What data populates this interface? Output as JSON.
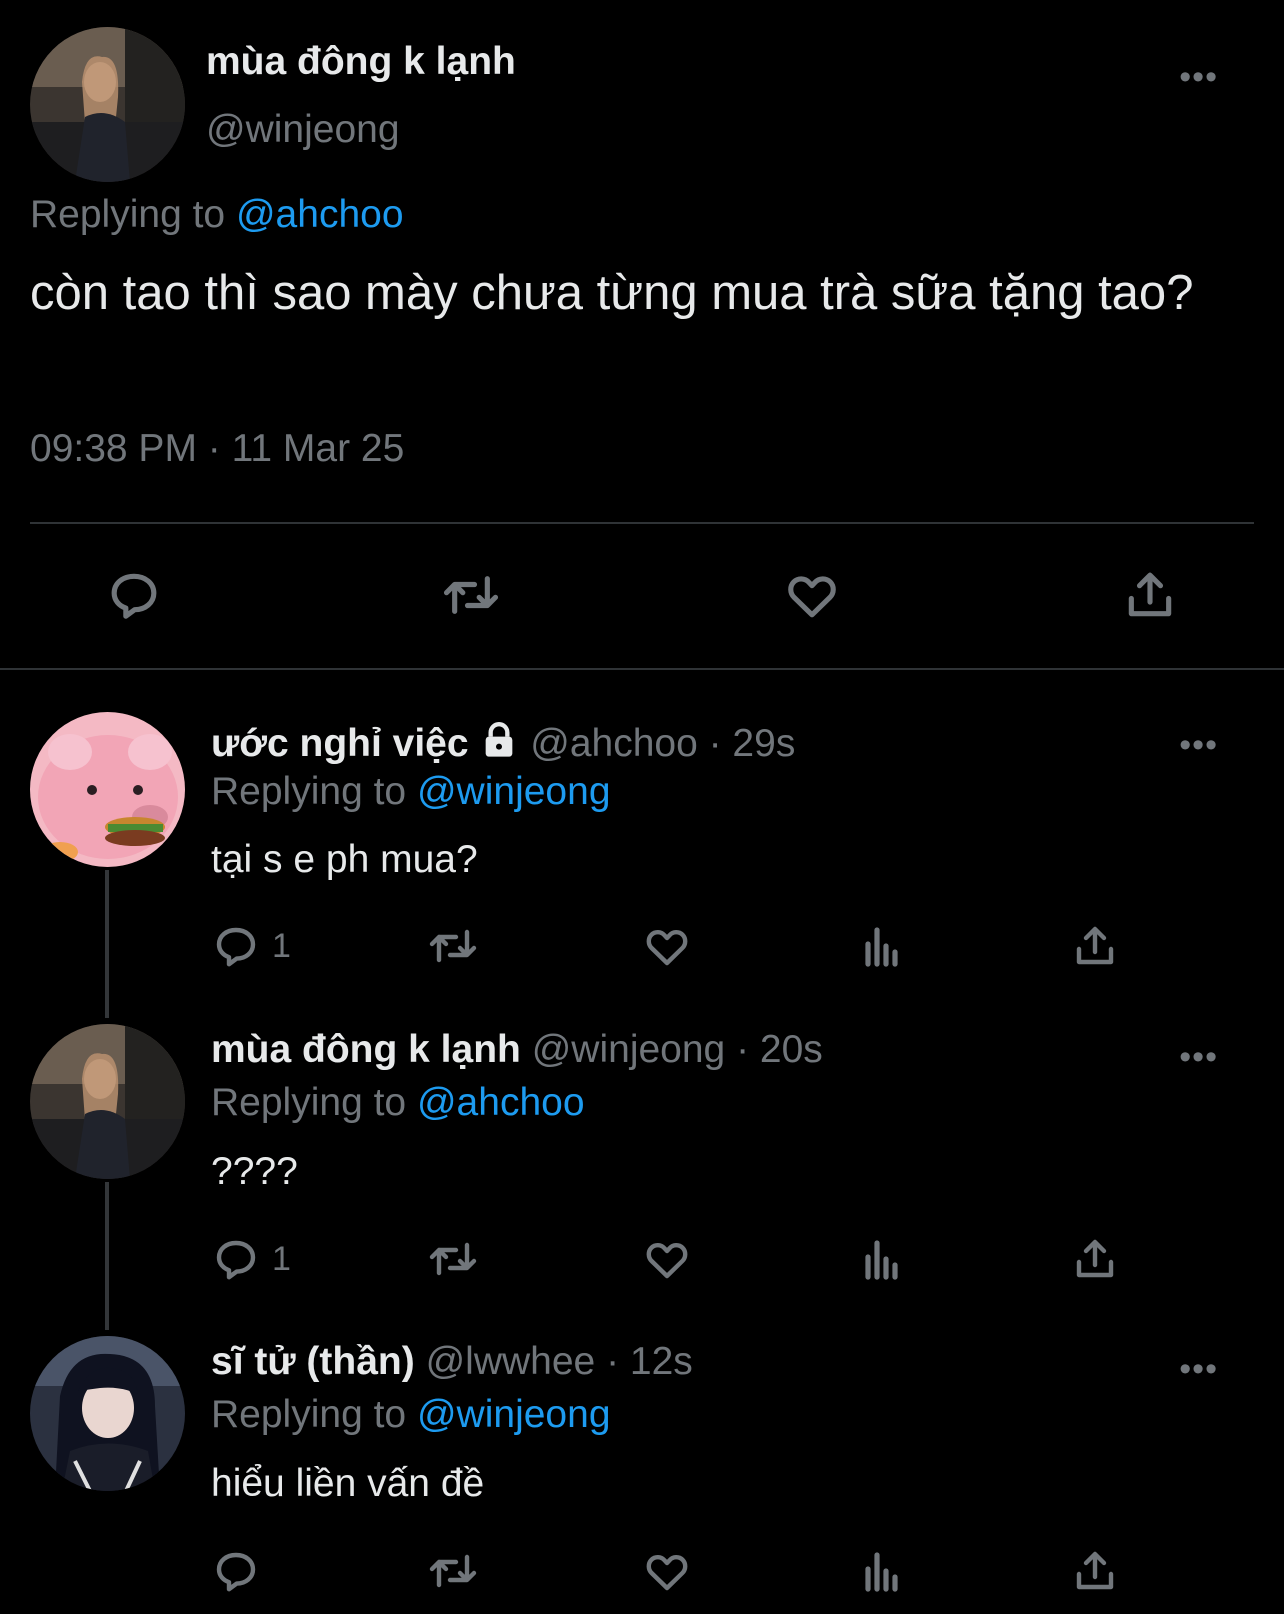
{
  "main_tweet": {
    "display_name": "mùa đông k lạnh",
    "handle": "@winjeong",
    "replying_label": "Replying to",
    "replying_handle": "@ahchoo",
    "text": "còn tao thì sao mày chưa từng mua trà sữa tặng tao?",
    "timestamp": "09:38 PM · 11 Mar 25",
    "actions": [
      "reply-icon",
      "retweet-icon",
      "like-icon",
      "share-icon"
    ]
  },
  "replies": [
    {
      "display_name": "ước nghỉ việc",
      "locked": true,
      "handle_time": "@ahchoo · 29s",
      "replying_label": "Replying to",
      "replying_handle": "@winjeong",
      "text": "tại s e ph mua?",
      "reply_count": "1"
    },
    {
      "display_name": "mùa đông k lạnh",
      "locked": false,
      "handle_time": "@winjeong · 20s",
      "replying_label": "Replying to",
      "replying_handle": "@ahchoo",
      "text": "????",
      "reply_count": "1"
    },
    {
      "display_name": "sĩ tử (thần)",
      "locked": false,
      "handle_time": "@lwwhee · 12s",
      "replying_label": "Replying to",
      "replying_handle": "@winjeong",
      "text": "hiểu liền vấn đề",
      "reply_count": ""
    }
  ],
  "more_label": "•••",
  "colors": {
    "background": "#000000",
    "text": "#e7e9ea",
    "muted": "#71767b",
    "link": "#1d9bf0",
    "divider": "#2f3336"
  }
}
